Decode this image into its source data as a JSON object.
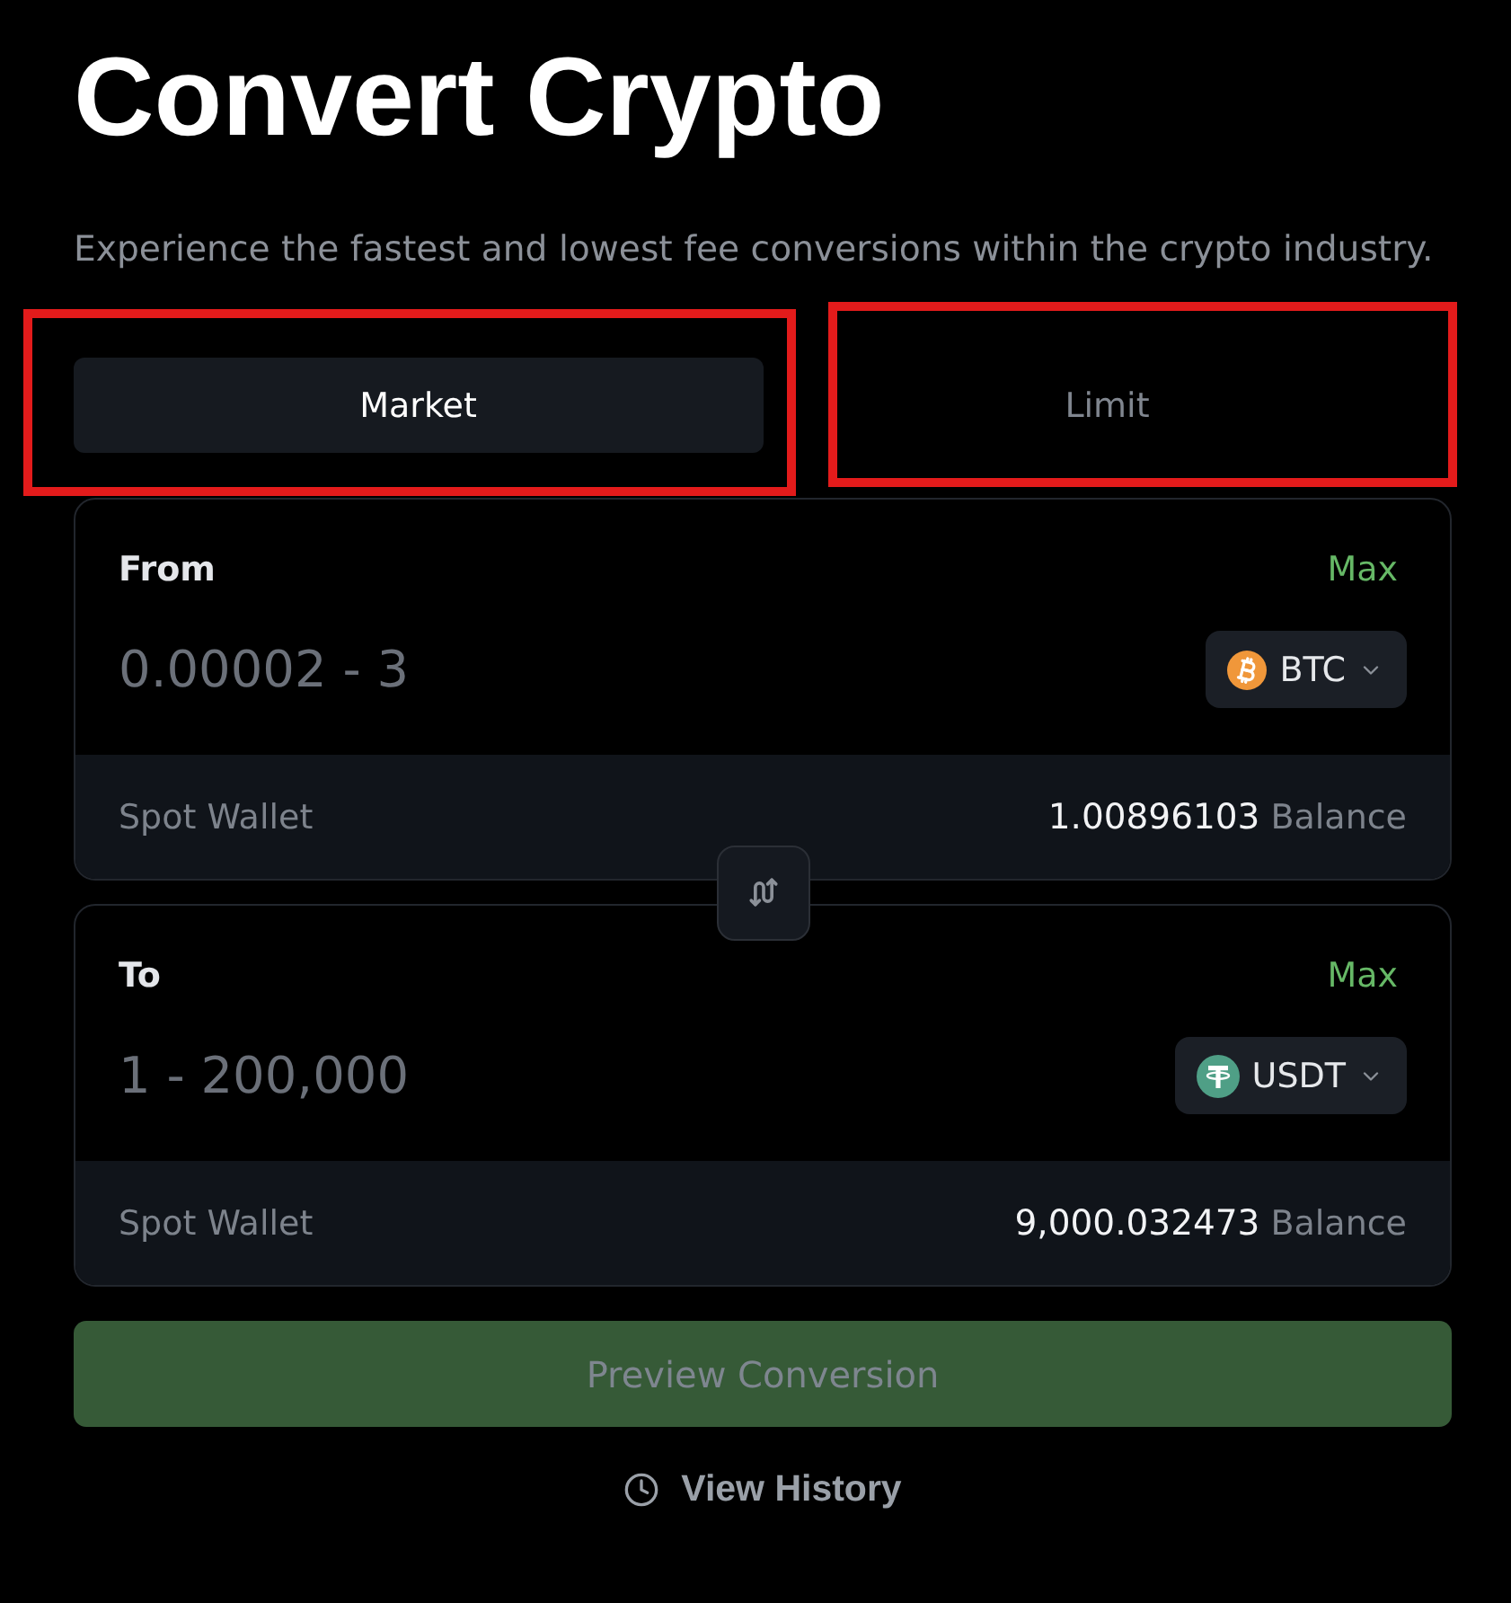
{
  "title": "Convert Crypto",
  "subtitle": "Experience the fastest and lowest fee conversions within the crypto industry.",
  "tabs": [
    {
      "label": "Market",
      "selected": true,
      "highlighted": true
    },
    {
      "label": "Limit",
      "selected": false,
      "highlighted": true
    }
  ],
  "panels": [
    {
      "label": "From",
      "max": "Max",
      "placeholder": "0.00002 - 3",
      "asset": {
        "kind": "btc",
        "symbol": "BTC"
      },
      "wallet": "Spot Wallet",
      "balance": "1.00896103",
      "balance_label": "Balance"
    },
    {
      "label": "To",
      "max": "Max",
      "placeholder": "1 - 200,000",
      "asset": {
        "kind": "usdt",
        "symbol": "USDT"
      },
      "wallet": "Spot Wallet",
      "balance": "9,000.032473",
      "balance_label": "Balance"
    }
  ],
  "preview_button": {
    "label": "Preview Conversion",
    "disabled": true
  },
  "history_link": {
    "label": "View History"
  }
}
